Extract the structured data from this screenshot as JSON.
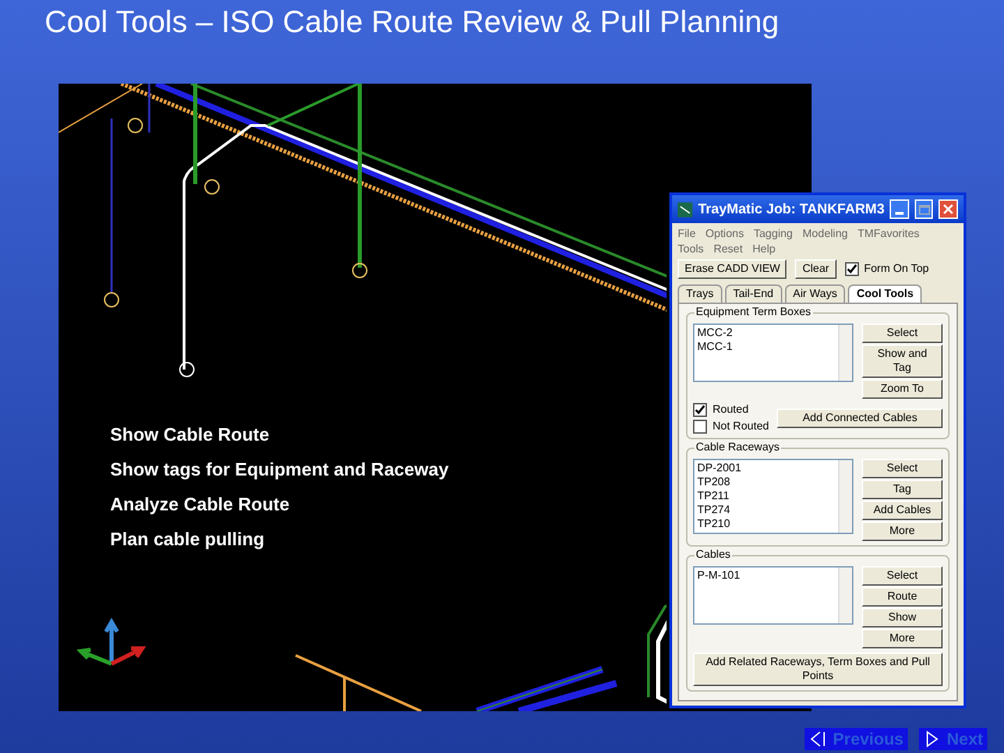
{
  "slide": {
    "title": "Cool Tools – ISO Cable Route Review & Pull Planning"
  },
  "viewport": {
    "bullets": [
      "Show Cable Route",
      "Show tags for Equipment and Raceway",
      "Analyze Cable Route",
      "Plan cable pulling"
    ]
  },
  "window": {
    "title": "TrayMatic Job: TANKFARM3",
    "menu": [
      [
        "File",
        "Options",
        "Tagging",
        "Modeling",
        "TMFavorites"
      ],
      [
        "Tools",
        "Reset",
        "Help"
      ]
    ],
    "toolbar": {
      "buttons": [
        "Erase CADD VIEW",
        "Clear"
      ],
      "checkbox": {
        "label": "Form On Top",
        "checked": true
      }
    },
    "tabs": [
      {
        "label": "Trays",
        "selected": false
      },
      {
        "label": "Tail-End",
        "selected": false
      },
      {
        "label": "Air Ways",
        "selected": false
      },
      {
        "label": "Cool Tools",
        "selected": true
      }
    ],
    "groups": [
      {
        "title": "Equipment Term Boxes",
        "items": [
          "MCC-2",
          "MCC-1"
        ],
        "buttons": [
          "Select",
          "Show and Tag",
          "Zoom To"
        ],
        "checks": [
          {
            "label": "Routed",
            "checked": true
          },
          {
            "label": "Not Routed",
            "checked": false
          }
        ],
        "wide_button": "Add Connected Cables"
      },
      {
        "title": "Cable Raceways",
        "items": [
          "DP-2001",
          "TP208",
          "TP211",
          "TP274",
          "TP210"
        ],
        "buttons": [
          "Select",
          "Tag",
          "Add Cables",
          "More"
        ]
      },
      {
        "title": "Cables",
        "items": [
          "P-M-101"
        ],
        "buttons": [
          "Select",
          "Route",
          "Show",
          "More"
        ],
        "wide_button": "Add Related Raceways, Term Boxes and Pull Points"
      }
    ]
  },
  "nav": [
    {
      "label": "Previous",
      "kind": "back"
    },
    {
      "label": "Next",
      "kind": "forward"
    }
  ]
}
